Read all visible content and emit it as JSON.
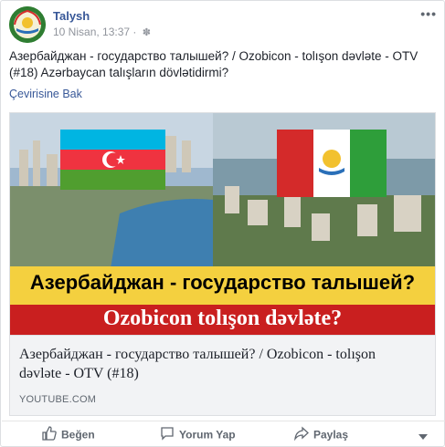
{
  "post": {
    "page_name": "Talysh",
    "timestamp": "10 Nisan, 13:37",
    "privacy_icon": "globe-icon",
    "more_icon": "more-options-icon",
    "text": "Азербайджан - государство талышей? / Ozobicon - tolışon dəvləte - OTV (#18) Azərbaycan talışların dövlətidirmi?",
    "translate_link": "Çevirisine Bak"
  },
  "card": {
    "banner_line1": "Азербайджан - государство талышей?",
    "banner_line2": "Ozobicon tolışon dəvləte?",
    "title": "Азербайджан - государство талышей? / Ozobicon - tolışon dəvləte - OTV (#18)",
    "domain": "YOUTUBE.COM"
  },
  "actions": {
    "like": "Beğen",
    "comment": "Yorum Yap",
    "share": "Paylaş",
    "reactions_menu_icon": "caret-down-icon"
  },
  "colors": {
    "link": "#385898",
    "meta": "#90949c",
    "banner_yellow": "#f4d03f",
    "banner_red": "#c91f1f",
    "card_bg": "#f2f3f5"
  }
}
